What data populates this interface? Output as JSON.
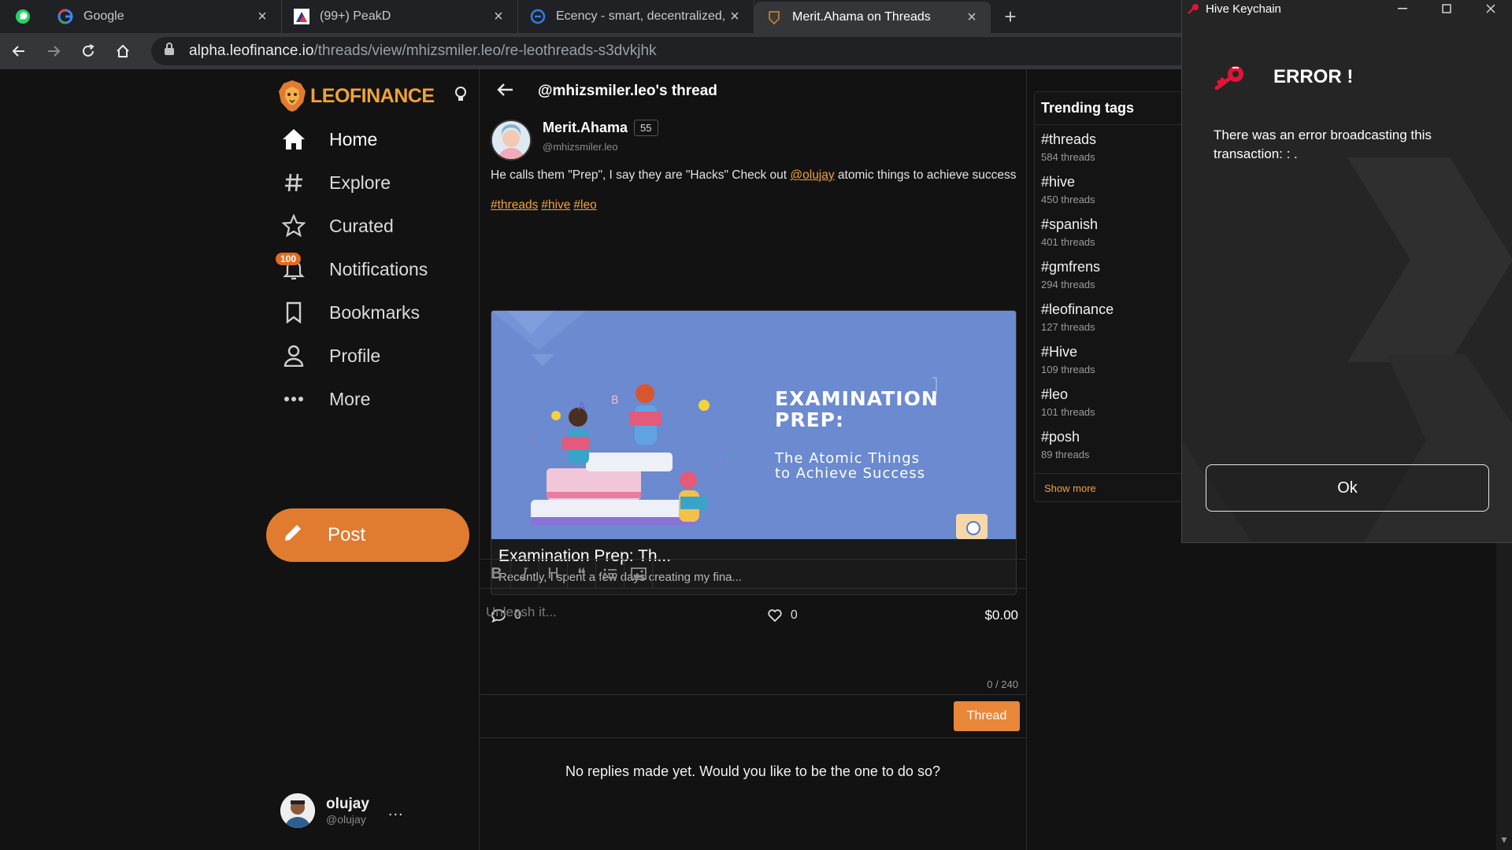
{
  "browser": {
    "tabs": [
      {
        "title": "Google",
        "icon": "google-icon"
      },
      {
        "title": "(99+) PeakD",
        "icon": "peakd-icon"
      },
      {
        "title": "Ecency - smart, decentralized, rewarding",
        "icon": "ecency-icon"
      },
      {
        "title": "Merit.Ahama on Threads",
        "icon": "leofinance-icon",
        "active": true
      }
    ],
    "new_tab": "+",
    "url_host": "alpha.leofinance.io",
    "url_path": "/threads/view/mhizsmiler.leo/re-leothreads-s3dvkjhk"
  },
  "sidebar": {
    "logo": "LEOFINANCE",
    "items": [
      {
        "label": "Home",
        "icon": "home-icon"
      },
      {
        "label": "Explore",
        "icon": "hash-icon"
      },
      {
        "label": "Curated",
        "icon": "star-icon"
      },
      {
        "label": "Notifications",
        "icon": "bell-icon",
        "badge": "100"
      },
      {
        "label": "Bookmarks",
        "icon": "bookmark-icon"
      },
      {
        "label": "Profile",
        "icon": "user-icon"
      },
      {
        "label": "More",
        "icon": "more-dots-icon"
      }
    ],
    "post_label": "Post",
    "user": {
      "name": "olujay",
      "handle": "@olujay",
      "more": "..."
    }
  },
  "thread": {
    "header_title": "@mhizsmiler.leo's thread",
    "author_name": "Merit.Ahama",
    "reputation": "55",
    "author_handle": "@mhizsmiler.leo",
    "text_before": "He calls them \"Prep\", I say they are \"Hacks\" Check out ",
    "mention": "@olujay",
    "text_after": " atomic things to achieve success",
    "tags": [
      "#threads",
      "#hive",
      "#leo"
    ],
    "card": {
      "image_title_1": "EXAMINATION",
      "image_title_2": "PREP:",
      "image_sub_1": "The Atomic Things",
      "image_sub_2": "to Achieve Success",
      "title": "Examination Prep: Th...",
      "description": "Recently, I spent a few days creating my fina..."
    },
    "comments": "0",
    "likes": "0",
    "payout": "$0.00"
  },
  "editor": {
    "toolbar": [
      "B",
      "I",
      "H",
      "❝",
      "list",
      "image"
    ],
    "placeholder": "Unleash it...",
    "counter": "0 / 240",
    "submit": "Thread"
  },
  "no_replies": "No replies made yet. Would you like to be the one to do so?",
  "trending": {
    "title": "Trending tags",
    "tags": [
      {
        "tag": "#threads",
        "count": "584 threads"
      },
      {
        "tag": "#hive",
        "count": "450 threads"
      },
      {
        "tag": "#spanish",
        "count": "401 threads"
      },
      {
        "tag": "#gmfrens",
        "count": "294 threads"
      },
      {
        "tag": "#leofinance",
        "count": "127 threads"
      },
      {
        "tag": "#Hive",
        "count": "109 threads"
      },
      {
        "tag": "#leo",
        "count": "101 threads"
      },
      {
        "tag": "#posh",
        "count": "89 threads"
      }
    ],
    "show_more": "Show more"
  },
  "keychain": {
    "window_title": "Hive Keychain",
    "error_title": "ERROR !",
    "message": "There was an error broadcasting this transaction: : .",
    "ok": "Ok"
  },
  "colors": {
    "accent": "#e07b2f",
    "link": "#f0a23a",
    "background": "#121212"
  }
}
